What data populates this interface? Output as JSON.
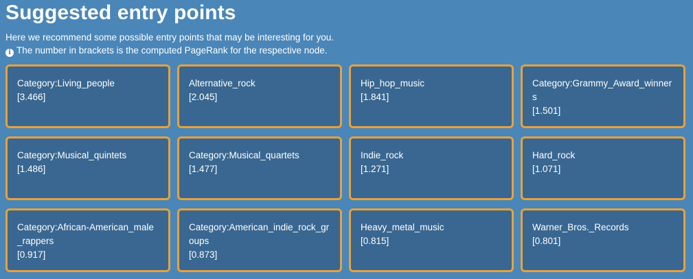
{
  "page": {
    "title": "Suggested entry points",
    "intro": "Here we recommend some possible entry points that may be interesting for you.",
    "note": "The number in brackets is the computed PageRank for the respective node.",
    "note_icon": "info-circle-icon",
    "colors": {
      "background": "#4a86b8",
      "card_background": "#396791",
      "card_border": "#e8a23b",
      "text": "#ffffff"
    }
  },
  "entry_points": [
    {
      "label": "Category:Living_people",
      "rank": "[3.466]"
    },
    {
      "label": "Alternative_rock",
      "rank": "[2.045]"
    },
    {
      "label": "Hip_hop_music",
      "rank": "[1.841]"
    },
    {
      "label": "Category:Grammy_Award_winners",
      "rank": "[1.501]"
    },
    {
      "label": "Category:Musical_quintets",
      "rank": "[1.486]"
    },
    {
      "label": "Category:Musical_quartets",
      "rank": "[1.477]"
    },
    {
      "label": "Indie_rock",
      "rank": "[1.271]"
    },
    {
      "label": "Hard_rock",
      "rank": "[1.071]"
    },
    {
      "label": "Category:African-American_male_rappers",
      "rank": "[0.917]"
    },
    {
      "label": "Category:American_indie_rock_groups",
      "rank": "[0.873]"
    },
    {
      "label": "Heavy_metal_music",
      "rank": "[0.815]"
    },
    {
      "label": "Warner_Bros._Records",
      "rank": "[0.801]"
    }
  ]
}
